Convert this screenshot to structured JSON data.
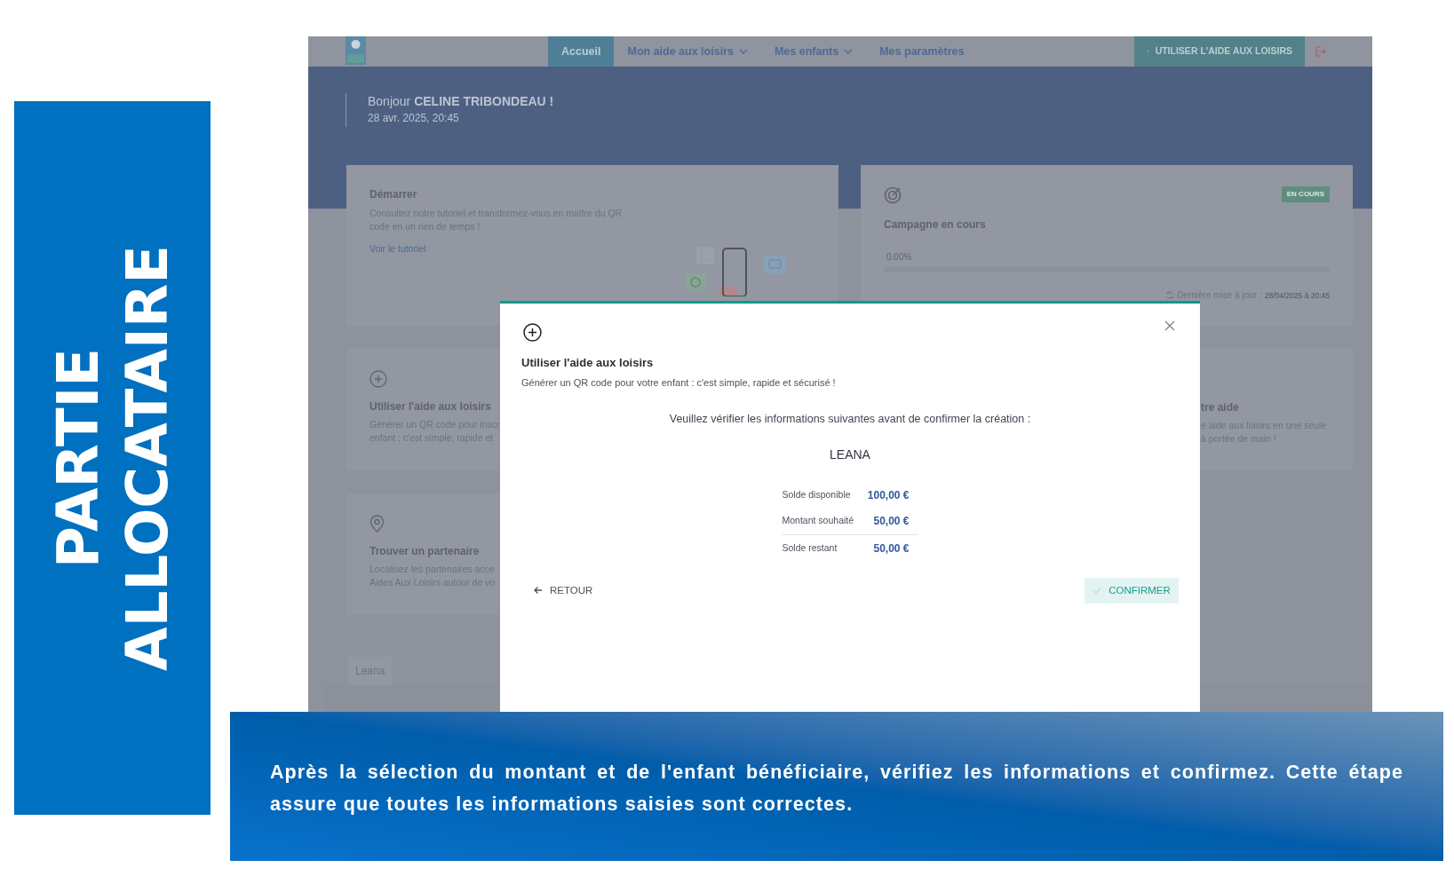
{
  "side_title": "PARTIE ALLOCATAIRE",
  "app": {
    "nav": {
      "tabs": [
        {
          "label": "Accueil",
          "selected": true,
          "dropdown": false
        },
        {
          "label": "Mon aide aux loisirs",
          "selected": false,
          "dropdown": true
        },
        {
          "label": "Mes enfants",
          "selected": false,
          "dropdown": true
        },
        {
          "label": "Mes paramètres",
          "selected": false,
          "dropdown": false
        }
      ],
      "action_button": "UTILISER L'AIDE AUX LOISIRS"
    },
    "greeting": "Bonjour **CELINE TRIBONDEAU !**",
    "date": "28 avr. 2025, 20:45",
    "cards": [
      {
        "kind": "tutorial",
        "title": "Démarrer",
        "lines": [
          "Consultez notre tutoriel et transformez-vous en maître du QR",
          "code en un rien de temps !"
        ],
        "link": "Voir le tutoriel"
      },
      {
        "kind": "campaign",
        "badge": "EN COURS",
        "title": "Campagne en cours",
        "progress_label": "0.00%",
        "level": 0,
        "updated_label": "Dernière mise à jour :",
        "updated_value": "28/04/2025 à 20:45"
      },
      {
        "kind": "use",
        "title": "Utiliser l'aide aux loisirs",
        "lines": [
          "Générer un QR code pour inscr",
          "enfant : c'est simple, rapide et"
        ]
      },
      {
        "kind": "info",
        "title": "tre aide",
        "lines": [
          "e aide aux loisirs en une seule",
          "à portée de main !"
        ]
      },
      {
        "kind": "partner",
        "title": "Trouver un partenaire",
        "lines": [
          "Localisez les partenaires acce",
          "Aides Aux Loisirs autour de vo"
        ]
      }
    ],
    "child_tab": "Leana"
  },
  "modal": {
    "title": "Utiliser l'aide aux loisirs",
    "subtitle": "Générer un QR code pour votre enfant : c'est simple, rapide et sécurisé !",
    "instruction": "Veuillez vérifier les informations suivantes avant de confirmer la création :",
    "child": "LEANA",
    "rows": [
      {
        "label": "Solde disponible",
        "value": "100,00 €"
      },
      {
        "label": "Montant souhaité",
        "value": "50,00 €"
      },
      {
        "label": "Solde restant",
        "value": "50,00 €"
      }
    ],
    "back_button": "RETOUR",
    "confirm_button": "CONFIRMER"
  },
  "caption": "Après la sélection du montant et de l'enfant bénéficiaire, vérifiez les informations et confirmez. Cette étape assure que toutes les informations saisies sont correctes."
}
